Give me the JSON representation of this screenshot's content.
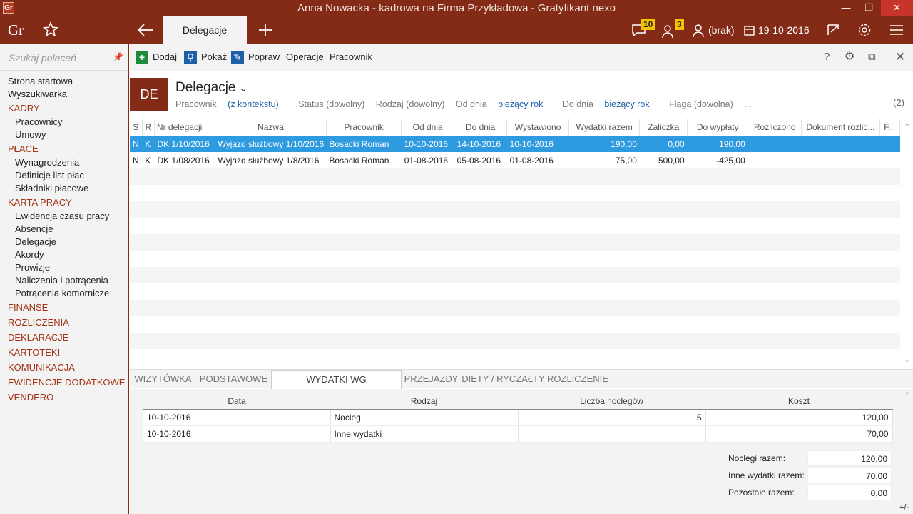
{
  "window": {
    "title": "Anna Nowacka - kadrowa na Firma Przykładowa - Gratyfikant nexo",
    "app_icon": "Gr"
  },
  "topbar": {
    "logo": "Gr",
    "active_tab": "Delegacje",
    "messages_count": "10",
    "tasks_count": "3",
    "user_label": "(brak)",
    "date": "19-10-2016"
  },
  "sidebar": {
    "search_placeholder": "Szukaj poleceń",
    "items": [
      {
        "label": "Strona startowa",
        "kind": "item"
      },
      {
        "label": "Wyszukiwarka",
        "kind": "item"
      },
      {
        "label": "KADRY",
        "kind": "sec"
      },
      {
        "label": "Pracownicy",
        "kind": "sub"
      },
      {
        "label": "Umowy",
        "kind": "sub"
      },
      {
        "label": "PŁACE",
        "kind": "sec"
      },
      {
        "label": "Wynagrodzenia",
        "kind": "sub"
      },
      {
        "label": "Definicje list płac",
        "kind": "sub"
      },
      {
        "label": "Składniki płacowe",
        "kind": "sub"
      },
      {
        "label": "KARTA PRACY",
        "kind": "sec"
      },
      {
        "label": "Ewidencja czasu pracy",
        "kind": "sub"
      },
      {
        "label": "Absencje",
        "kind": "sub"
      },
      {
        "label": "Delegacje",
        "kind": "sub"
      },
      {
        "label": "Akordy",
        "kind": "sub"
      },
      {
        "label": "Prowizje",
        "kind": "sub"
      },
      {
        "label": "Naliczenia i potrącenia",
        "kind": "sub"
      },
      {
        "label": "Potrącenia komornicze",
        "kind": "sub"
      },
      {
        "label": "FINANSE",
        "kind": "sec"
      },
      {
        "label": "ROZLICZENIA",
        "kind": "sec"
      },
      {
        "label": "DEKLARACJE",
        "kind": "sec"
      },
      {
        "label": "KARTOTEKI",
        "kind": "sec"
      },
      {
        "label": "KOMUNIKACJA",
        "kind": "sec"
      },
      {
        "label": "EWIDENCJE DODATKOWE",
        "kind": "sec"
      },
      {
        "label": "VENDERO",
        "kind": "sec"
      }
    ]
  },
  "toolbar": {
    "add": "Dodaj",
    "show": "Pokaż",
    "edit": "Popraw",
    "operations": "Operacje",
    "employee": "Pracownik",
    "help": "?"
  },
  "header": {
    "badge": "DE",
    "title": "Delegacje",
    "count": "(2)",
    "f_employee": "Pracownik",
    "f_employee_val": "(z kontekstu)",
    "f_status": "Status (dowolny)",
    "f_type": "Rodzaj (dowolny)",
    "f_from": "Od dnia",
    "f_from_val": "bieżący rok",
    "f_to": "Do dnia",
    "f_to_val": "bieżący rok",
    "f_flag": "Flaga (dowolna)",
    "f_more": "..."
  },
  "grid": {
    "columns": [
      "S",
      "R",
      "Nr delegacji",
      "Nazwa",
      "Pracownik",
      "Od dnia",
      "Do dnia",
      "Wystawiono",
      "Wydatki razem",
      "Zaliczka",
      "Do wypłaty",
      "Rozliczono",
      "Dokument rozlic...",
      "F..."
    ],
    "rows": [
      [
        "N",
        "K",
        "DK 1/10/2016",
        "Wyjazd służbowy 1/10/2016",
        "Bosacki Roman",
        "10-10-2016",
        "14-10-2016",
        "10-10-2016",
        "190,00",
        "0,00",
        "190,00",
        "",
        "",
        ""
      ],
      [
        "N",
        "K",
        "DK 1/08/2016",
        "Wyjazd służbowy 1/8/2016",
        "Bosacki Roman",
        "01-08-2016",
        "05-08-2016",
        "01-08-2016",
        "75,00",
        "500,00",
        "-425,00",
        "",
        "",
        ""
      ]
    ]
  },
  "detail_tabs": [
    "WIZYTÓWKA",
    "PODSTAWOWE",
    "WYDATKI WG ZAŁĄCZNIKÓW",
    "PRZEJAZDY",
    "DIETY / RYCZAŁTY",
    "ROZLICZENIE"
  ],
  "detail": {
    "columns": [
      "Data",
      "Rodzaj",
      "Liczba noclegów",
      "Koszt"
    ],
    "rows": [
      [
        "10-10-2016",
        "Nocleg",
        "5",
        "120,00"
      ],
      [
        "10-10-2016",
        "Inne wydatki",
        "",
        "70,00"
      ]
    ],
    "sum_nocleg_label": "Noclegi razem:",
    "sum_nocleg": "120,00",
    "sum_inne_label": "Inne wydatki razem:",
    "sum_inne": "70,00",
    "sum_rest_label": "Pozostałe razem:",
    "sum_rest": "0,00",
    "corner": "+/-"
  }
}
